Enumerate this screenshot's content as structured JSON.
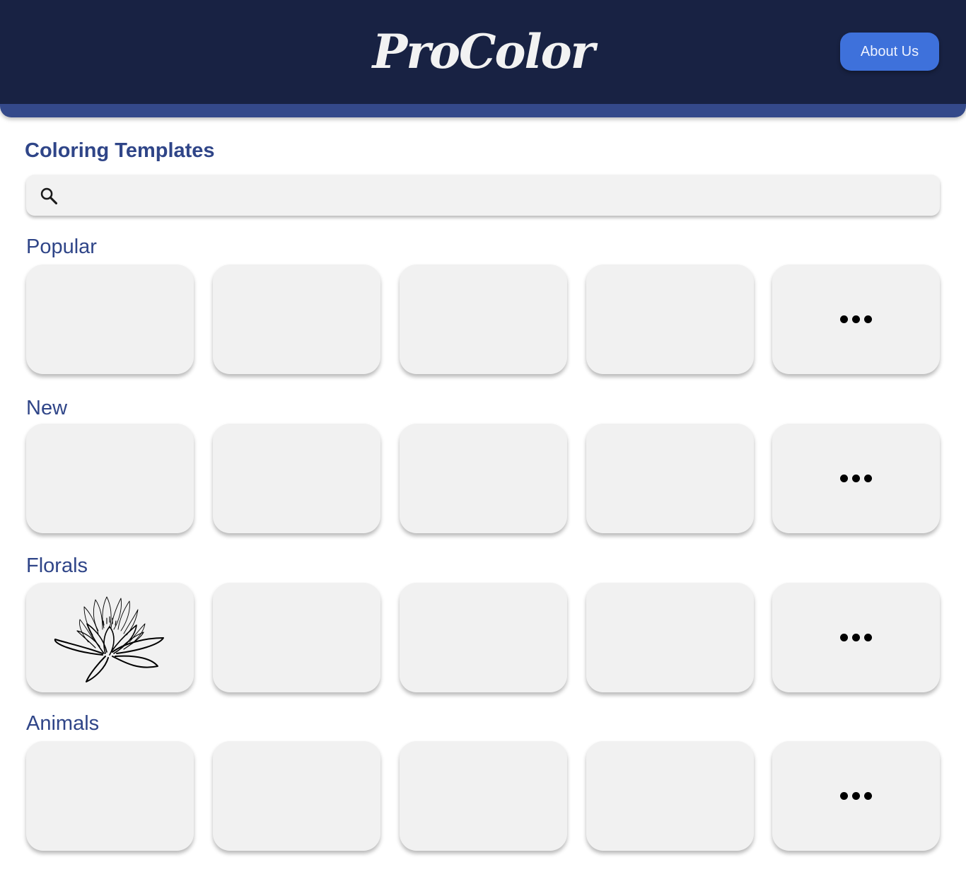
{
  "header": {
    "logo": "ProColor",
    "about_label": "About Us"
  },
  "page": {
    "title": "Coloring Templates"
  },
  "search": {
    "placeholder": "",
    "value": "",
    "icon": "search-icon"
  },
  "sections": [
    {
      "title": "Popular",
      "items": [
        "",
        "",
        "",
        ""
      ],
      "more_icon": "more-dots-icon"
    },
    {
      "title": "New",
      "items": [
        "",
        "",
        "",
        ""
      ],
      "more_icon": "more-dots-icon"
    },
    {
      "title": "Florals",
      "items": [
        "lotus-flower-template",
        "",
        "",
        ""
      ],
      "more_icon": "more-dots-icon"
    },
    {
      "title": "Animals",
      "items": [
        "",
        "",
        "",
        ""
      ],
      "more_icon": "more-dots-icon"
    }
  ],
  "colors": {
    "header_bg": "#182243",
    "header_accent": "#34498a",
    "button_bg": "#3e71db",
    "title_text": "#2f4588",
    "card_bg": "#f1f1f1"
  }
}
